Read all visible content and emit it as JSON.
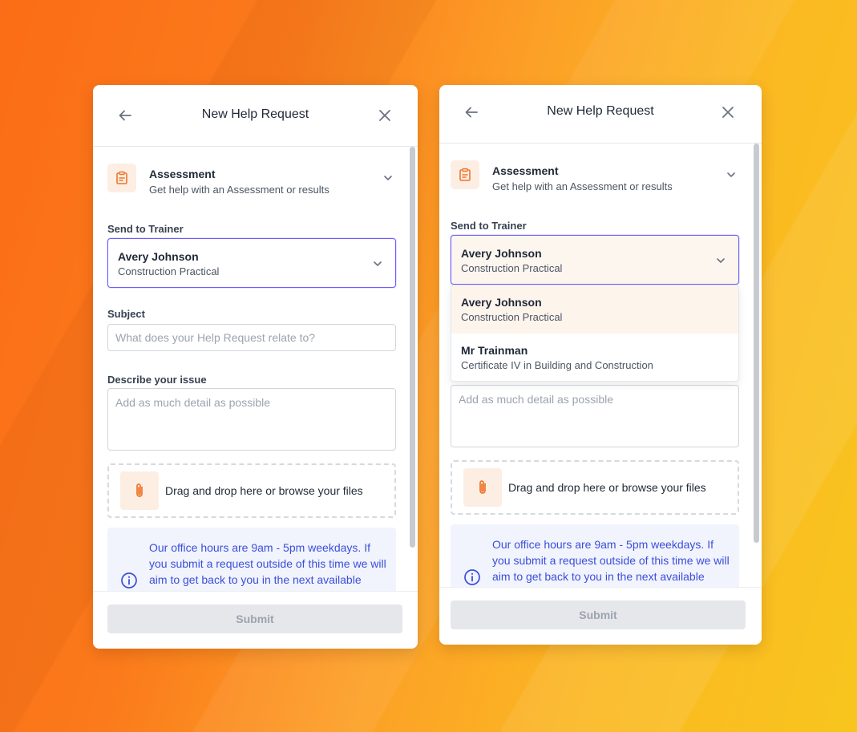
{
  "header": {
    "title": "New Help Request"
  },
  "category": {
    "title": "Assessment",
    "subtitle": "Get help with an Assessment or results"
  },
  "trainer": {
    "label": "Send to Trainer",
    "selected_name": "Avery Johnson",
    "selected_course": "Construction Practical",
    "options": [
      {
        "name": "Avery Johnson",
        "course": "Construction Practical"
      },
      {
        "name": "Mr Trainman",
        "course": "Certificate IV in Building and Construction"
      }
    ]
  },
  "subject": {
    "label": "Subject",
    "placeholder": "What does your Help Request relate to?"
  },
  "issue": {
    "label": "Describe your issue",
    "placeholder": "Add as much detail as possible"
  },
  "dropzone": {
    "text": "Drag and drop here or browse your files"
  },
  "info": {
    "text": "Our office hours are 9am - 5pm weekdays. If you submit a request outside of this time we will aim to get back to you in the next available business day. An email notification will be sent"
  },
  "footer": {
    "submit_label": "Submit"
  },
  "colors": {
    "accent_orange": "#f0742a",
    "focus_border": "#6d5dfc",
    "info_text": "#3b4fd8",
    "info_bg": "#f1f3fd"
  },
  "icons": {
    "back": "arrow-left-icon",
    "close": "close-icon",
    "category": "clipboard-icon",
    "chevron": "chevron-down-icon",
    "attach": "paperclip-icon",
    "info": "info-circle-icon"
  }
}
